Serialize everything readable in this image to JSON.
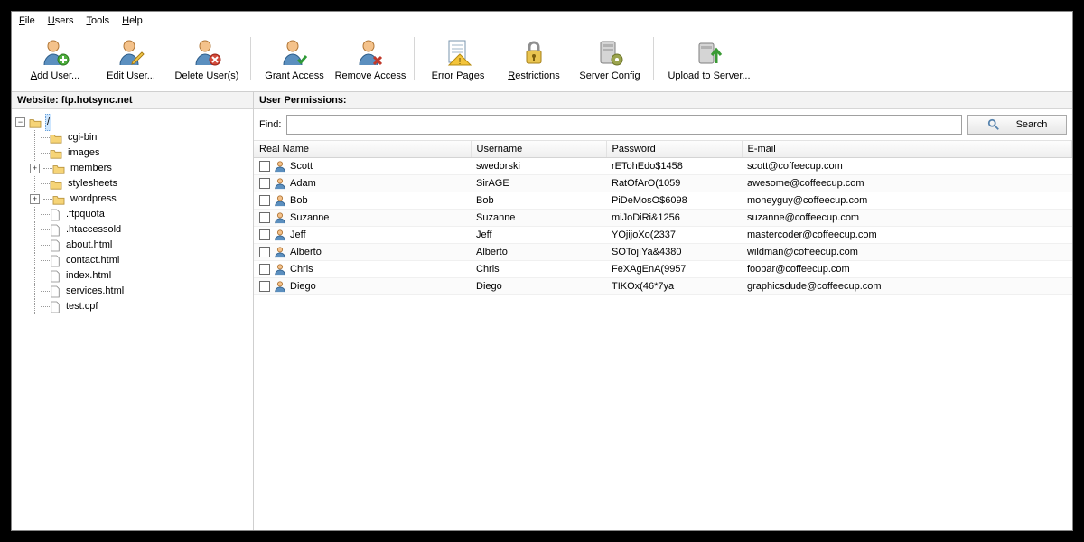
{
  "menu": {
    "file": "File",
    "users": "Users",
    "tools": "Tools",
    "help": "Help"
  },
  "toolbar": {
    "add_user": "Add User...",
    "edit_user": "Edit User...",
    "delete_users": "Delete User(s)",
    "grant_access": "Grant Access",
    "remove_access": "Remove Access",
    "error_pages": "Error Pages",
    "restrictions": "Restrictions",
    "server_config": "Server Config",
    "upload": "Upload to Server..."
  },
  "left": {
    "header": "Website: ftp.hotsync.net",
    "root": "/",
    "folders": {
      "cgi_bin": "cgi-bin",
      "images": "images",
      "members": "members",
      "stylesheets": "stylesheets",
      "wordpress": "wordpress"
    },
    "files": {
      "ftpquota": ".ftpquota",
      "htaccessold": ".htaccessold",
      "about": "about.html",
      "contact": "contact.html",
      "index": "index.html",
      "services": "services.html",
      "test": "test.cpf"
    }
  },
  "right": {
    "header": "User Permissions:",
    "find_label": "Find:",
    "search_label": "Search",
    "columns": {
      "real_name": "Real Name",
      "username": "Username",
      "password": "Password",
      "email": "E-mail"
    },
    "rows": [
      {
        "name": "Scott",
        "user": "swedorski",
        "pass": "rETohEdo$1458",
        "email": "scott@coffeecup.com"
      },
      {
        "name": "Adam",
        "user": "SirAGE",
        "pass": "RatOfArO(1059",
        "email": "awesome@coffeecup.com"
      },
      {
        "name": "Bob",
        "user": "Bob",
        "pass": "PiDeMosO$6098",
        "email": "moneyguy@coffeecup.com"
      },
      {
        "name": "Suzanne",
        "user": "Suzanne",
        "pass": "miJoDiRi&1256",
        "email": "suzanne@coffeecup.com"
      },
      {
        "name": "Jeff",
        "user": "Jeff",
        "pass": "YOjijoXo(2337",
        "email": "mastercoder@coffeecup.com"
      },
      {
        "name": "Alberto",
        "user": "Alberto",
        "pass": "SOTojIYa&4380",
        "email": "wildman@coffeecup.com"
      },
      {
        "name": "Chris",
        "user": "Chris",
        "pass": "FeXAgEnA(9957",
        "email": "foobar@coffeecup.com"
      },
      {
        "name": "Diego",
        "user": "Diego",
        "pass": "TIKOx(46*7ya",
        "email": "graphicsdude@coffeecup.com"
      }
    ]
  }
}
